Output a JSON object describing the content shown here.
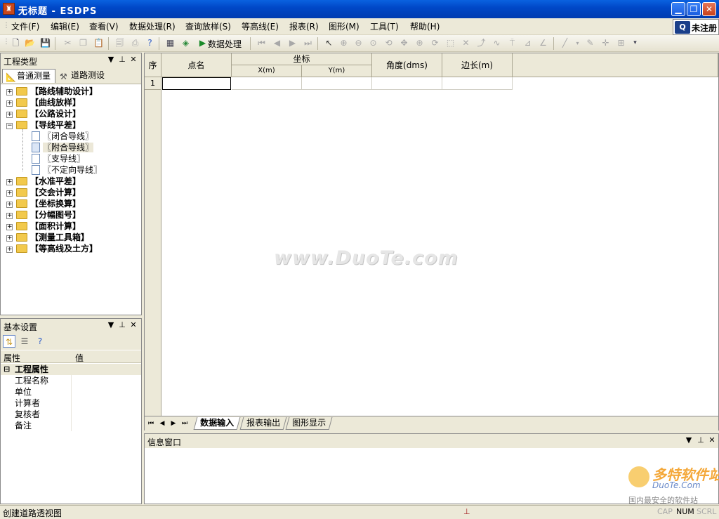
{
  "window": {
    "title": "无标题 - ESDPS",
    "icon": "surveyor-app-icon",
    "controls": [
      "minimize",
      "restore",
      "close"
    ]
  },
  "menu": [
    {
      "label": "文件(F)"
    },
    {
      "label": "编辑(E)"
    },
    {
      "label": "查看(V)"
    },
    {
      "label": "数据处理(R)"
    },
    {
      "label": "查询放样(S)"
    },
    {
      "label": "等高线(E)"
    },
    {
      "label": "报表(R)"
    },
    {
      "label": "图形(M)"
    },
    {
      "label": "工具(T)"
    },
    {
      "label": "帮助(H)"
    }
  ],
  "registration": {
    "label": "未注册"
  },
  "toolbar": {
    "process_label": "数据处理",
    "icons": [
      "new-icon",
      "open-icon",
      "save-icon",
      "cut-icon",
      "copy-icon",
      "paste-icon",
      "preview-icon",
      "print-icon",
      "help-icon",
      "table-icon",
      "map-icon",
      "run-icon",
      "first-icon",
      "prev-icon",
      "next-icon",
      "last-icon",
      "pointer-icon",
      "zoom-in-icon",
      "zoom-out-icon",
      "zoom-window-icon",
      "zoom-prev-icon",
      "pan-icon",
      "zoom-all-icon",
      "refresh-icon",
      "select-icon",
      "cross-icon",
      "export-icon",
      "curve-icon",
      "tower-icon",
      "measure-icon",
      "angle-icon",
      "line-icon",
      "pen-icon",
      "move-icon",
      "frame-icon"
    ]
  },
  "left_panel": {
    "title": "工程类型",
    "tabs": [
      {
        "label": "普通测量",
        "icon": "survey-icon"
      },
      {
        "label": "道路测设",
        "icon": "tools-icon"
      }
    ],
    "tree": [
      {
        "label": "【路线辅助设计】",
        "type": "folder",
        "expanded": false
      },
      {
        "label": "【曲线放样】",
        "type": "folder",
        "expanded": false
      },
      {
        "label": "【公路设计】",
        "type": "folder",
        "expanded": false
      },
      {
        "label": "【导线平差】",
        "type": "folder",
        "expanded": true,
        "children": [
          {
            "label": "〖闭合导线〗"
          },
          {
            "label": "〖附合导线〗",
            "selected": true
          },
          {
            "label": "〖支导线〗"
          },
          {
            "label": "〖不定向导线〗"
          }
        ]
      },
      {
        "label": "【水准平差】",
        "type": "folder",
        "expanded": false
      },
      {
        "label": "【交会计算】",
        "type": "folder",
        "expanded": false
      },
      {
        "label": "【坐标换算】",
        "type": "folder",
        "expanded": false
      },
      {
        "label": "【分幅图号】",
        "type": "folder",
        "expanded": false
      },
      {
        "label": "【面积计算】",
        "type": "folder",
        "expanded": false
      },
      {
        "label": "【测量工具箱】",
        "type": "folder",
        "expanded": false
      },
      {
        "label": "【等高线及土方】",
        "type": "folder",
        "expanded": false
      }
    ]
  },
  "settings_panel": {
    "title": "基本设置",
    "header_key": "属性",
    "header_value": "值",
    "category": "工程属性",
    "rows": [
      {
        "key": "工程名称",
        "value": ""
      },
      {
        "key": "单位",
        "value": ""
      },
      {
        "key": "计算者",
        "value": ""
      },
      {
        "key": "复核者",
        "value": ""
      },
      {
        "key": "备注",
        "value": ""
      }
    ]
  },
  "grid": {
    "headers": {
      "seq": "序",
      "name": "点名",
      "coord_group": "坐标",
      "x": "X(m)",
      "y": "Y(m)",
      "angle": "角度(dms)",
      "length": "边长(m)"
    },
    "rows": [
      {
        "seq": "1",
        "name": "",
        "x": "",
        "y": "",
        "angle": "",
        "length": ""
      }
    ]
  },
  "sheet_tabs": [
    {
      "label": "数据输入",
      "active": true
    },
    {
      "label": "报表输出",
      "active": false
    },
    {
      "label": "图形显示",
      "active": false
    }
  ],
  "info_window": {
    "title": "信息窗口"
  },
  "status": {
    "text": "创建道路透视图",
    "indicators": [
      {
        "label": "CAP",
        "on": false
      },
      {
        "label": "NUM",
        "on": true
      },
      {
        "label": "SCRL",
        "on": false
      }
    ]
  },
  "watermark": {
    "main": "www.DuoTe.com",
    "logo_title": "多特软件站",
    "logo_sub": "DuoTe.Com",
    "logo_tagline": "国内最安全的软件站"
  }
}
